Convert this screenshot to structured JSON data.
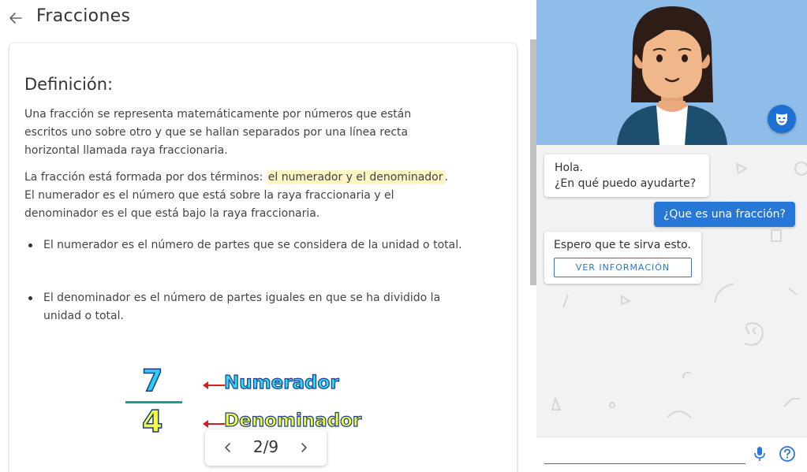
{
  "header": {
    "title": "Fracciones",
    "back_icon": "arrow-left-icon"
  },
  "content": {
    "definition_title": "Definición:",
    "paragraph1": "Una fracción se representa matemáticamente por números que están escritos uno sobre otro y que se hallan separados por una línea recta horizontal llamada raya fraccionaria.",
    "paragraph2_before": "La fracción está formada por dos términos: ",
    "paragraph2_highlight": "el numerador y el denominador",
    "paragraph2_after": ". El numerador es el número que está sobre la raya fraccionaria y el denominador es el que está bajo la raya fraccionaria.",
    "bullets": [
      "El numerador es el número de partes que se considera de la unidad o total.",
      "El denominador es el número de partes iguales en que se ha dividido la unidad o total."
    ],
    "highlight_color": "#fdf6c4"
  },
  "illustration": {
    "numerator": "7",
    "denominator": "4",
    "numerator_label": "Numerador",
    "denominator_label": "Denominador"
  },
  "pager": {
    "current": 2,
    "total": 9,
    "text": "2/9",
    "prev_icon": "chevron-left-icon",
    "next_icon": "chevron-right-icon"
  },
  "assistant": {
    "avatar_bg": "#8fbde9",
    "mask_icon": "theater-mask-icon",
    "messages": [
      {
        "from": "bot",
        "lines": [
          "Hola.",
          "¿En qué puedo ayudarte?"
        ]
      },
      {
        "from": "user",
        "text": "¿Que es una fracción?"
      },
      {
        "from": "bot",
        "text": "Espero que te sirva esto.",
        "button": "VER INFORMACIÓN"
      }
    ],
    "accent_color": "#2778d6"
  },
  "input": {
    "value": "",
    "placeholder": "",
    "mic_icon": "microphone-icon",
    "help_icon": "help-circle-icon"
  }
}
